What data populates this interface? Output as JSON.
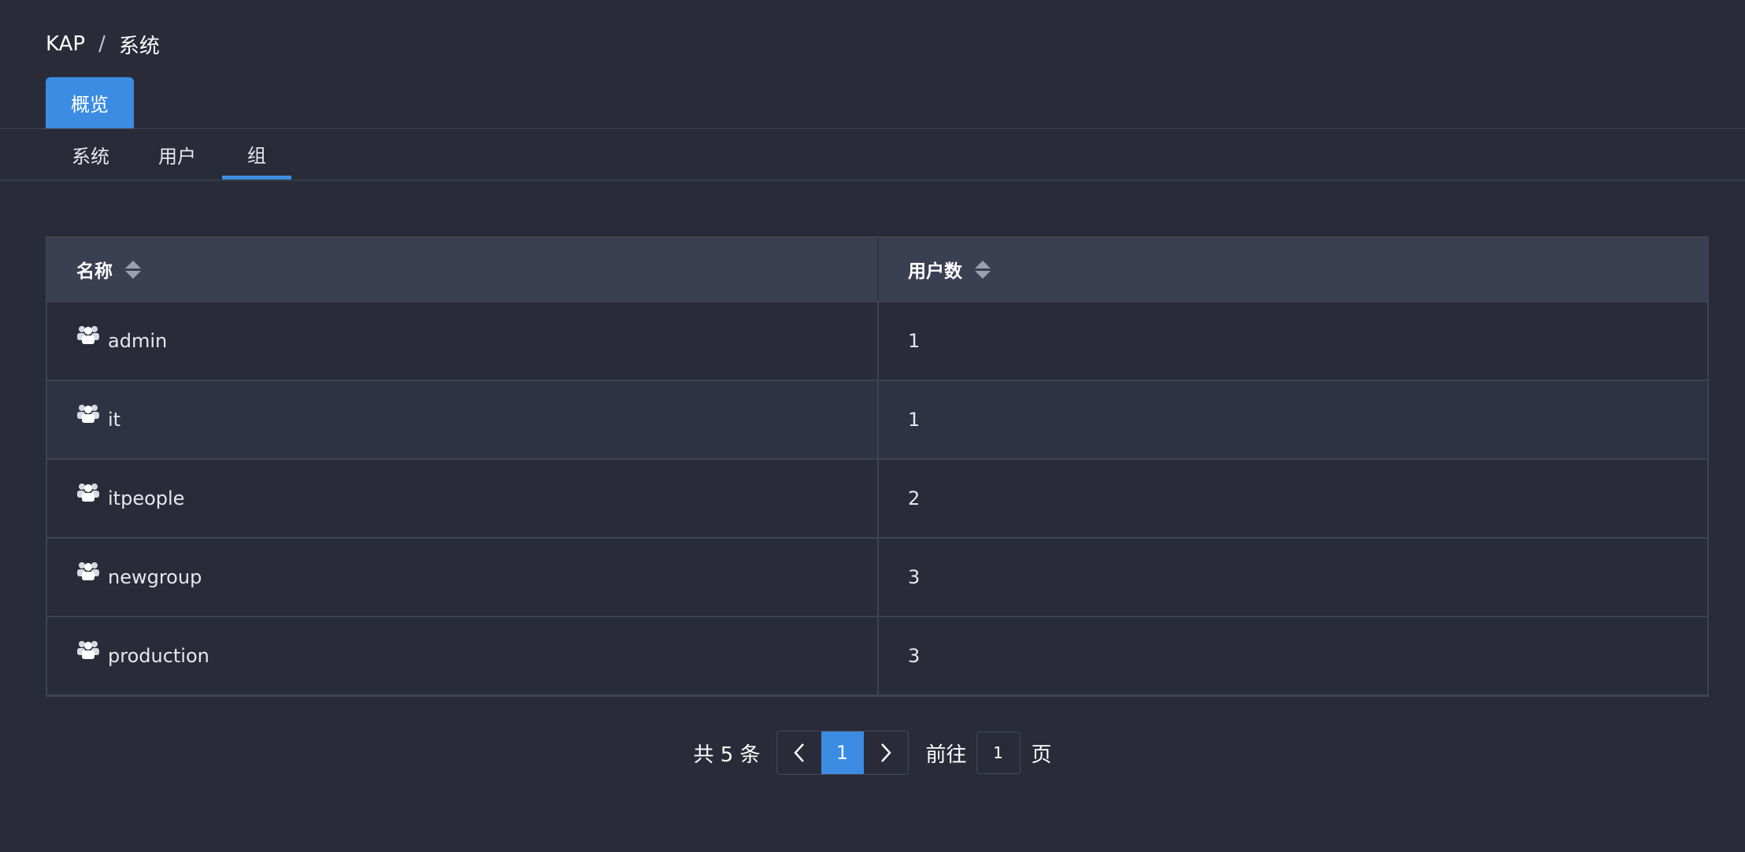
{
  "breadcrumb": {
    "root": "KAP",
    "separator": "/",
    "current": "系统"
  },
  "top_tab": {
    "label": "概览"
  },
  "sub_tabs": [
    {
      "label": "系统"
    },
    {
      "label": "用户"
    },
    {
      "label": "组"
    }
  ],
  "table": {
    "headers": {
      "name": "名称",
      "user_count": "用户数"
    },
    "rows": [
      {
        "name": "admin",
        "user_count": "1"
      },
      {
        "name": "it",
        "user_count": "1"
      },
      {
        "name": "itpeople",
        "user_count": "2"
      },
      {
        "name": "newgroup",
        "user_count": "3"
      },
      {
        "name": "production",
        "user_count": "3"
      }
    ]
  },
  "pagination": {
    "total_label": "共 5 条",
    "current_page": "1",
    "goto_label": "前往",
    "goto_value": "1",
    "page_suffix": "页"
  },
  "colors": {
    "accent": "#3b8ce2",
    "background": "#292c38",
    "header_bg": "#3a3f52"
  }
}
